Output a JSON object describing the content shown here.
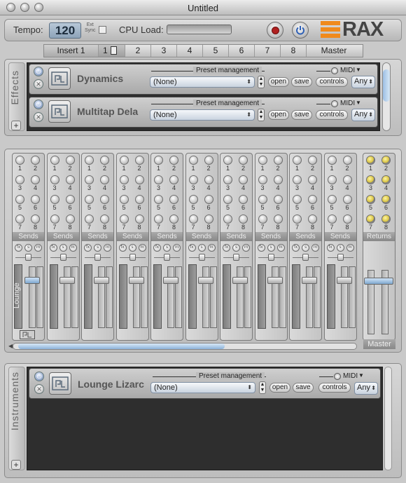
{
  "window": {
    "title": "Untitled"
  },
  "toolbar": {
    "tempo_label": "Tempo:",
    "tempo_value": "120",
    "ext_sync_line1": "Ext",
    "ext_sync_line2": "Sync",
    "cpu_label": "CPU Load:",
    "record_icon": "record-icon",
    "power_icon": "power-icon",
    "logo_text": "RAX",
    "accent_color": "#f08a1c"
  },
  "tabs": [
    "Insert 1",
    "1",
    "2",
    "3",
    "4",
    "5",
    "6",
    "7",
    "8",
    "Master"
  ],
  "effects": {
    "section_label": "Effects",
    "plugins": [
      {
        "name": "Dynamics",
        "preset_label": "Preset management",
        "preset_value": "(None)",
        "open": "open",
        "save": "save",
        "midi": "MIDI",
        "controls": "controls",
        "channel": "Any"
      },
      {
        "name": "Multitap Dela",
        "preset_label": "Preset management",
        "preset_value": "(None)",
        "open": "open",
        "save": "save",
        "midi": "MIDI",
        "controls": "controls",
        "channel": "Any"
      }
    ]
  },
  "mixer": {
    "knob_numbers": [
      "1",
      "2",
      "3",
      "4",
      "5",
      "6",
      "7",
      "8"
    ],
    "sends_label": "Sends",
    "returns_label": "Returns",
    "fx_labels": [
      "fx",
      "s",
      "m"
    ],
    "first_channel_name": "Lounge",
    "master_label": "Master",
    "channel_count": 10
  },
  "instruments": {
    "section_label": "Instruments",
    "plugins": [
      {
        "name": "Lounge Lizarc",
        "preset_label": "Preset management",
        "preset_value": "(None)",
        "open": "open",
        "save": "save",
        "midi": "MIDI",
        "controls": "controls",
        "channel": "Any"
      }
    ]
  }
}
